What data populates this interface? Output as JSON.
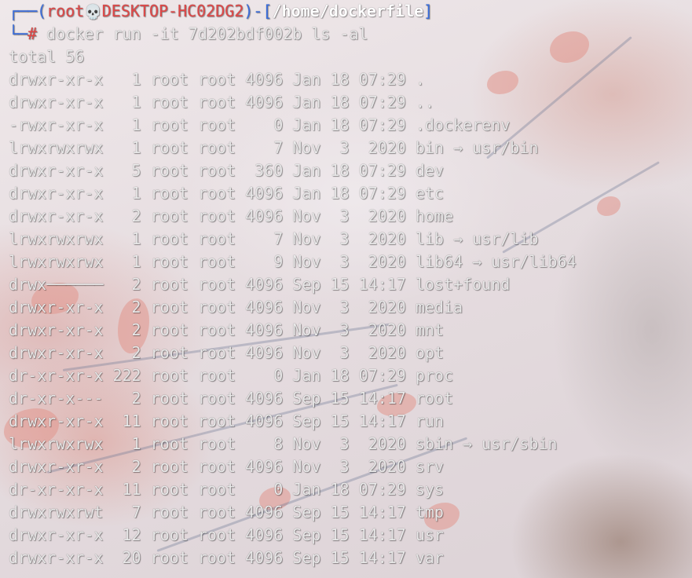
{
  "prompt": {
    "corner_top": "┌──(",
    "user": "root",
    "skull": "💀",
    "host": "DESKTOP-HC02DG2",
    "mid": ")-[",
    "path": "/home/dockerfile",
    "end": "]",
    "corner_bottom": "└─",
    "symbol": "#",
    "command": " docker run -it 7d202bdf002b ls -al"
  },
  "total_line": "total 56",
  "listing": [
    {
      "perms": "drwxr-xr-x",
      "links": "1",
      "owner": "root",
      "group": "root",
      "size": "4096",
      "date": "Jan 18 07:29",
      "name": "."
    },
    {
      "perms": "drwxr-xr-x",
      "links": "1",
      "owner": "root",
      "group": "root",
      "size": "4096",
      "date": "Jan 18 07:29",
      "name": ".."
    },
    {
      "perms": "-rwxr-xr-x",
      "links": "1",
      "owner": "root",
      "group": "root",
      "size": "0",
      "date": "Jan 18 07:29",
      "name": ".dockerenv"
    },
    {
      "perms": "lrwxrwxrwx",
      "links": "1",
      "owner": "root",
      "group": "root",
      "size": "7",
      "date": "Nov  3  2020",
      "name": "bin → usr/bin"
    },
    {
      "perms": "drwxr-xr-x",
      "links": "5",
      "owner": "root",
      "group": "root",
      "size": "360",
      "date": "Jan 18 07:29",
      "name": "dev"
    },
    {
      "perms": "drwxr-xr-x",
      "links": "1",
      "owner": "root",
      "group": "root",
      "size": "4096",
      "date": "Jan 18 07:29",
      "name": "etc"
    },
    {
      "perms": "drwxr-xr-x",
      "links": "2",
      "owner": "root",
      "group": "root",
      "size": "4096",
      "date": "Nov  3  2020",
      "name": "home"
    },
    {
      "perms": "lrwxrwxrwx",
      "links": "1",
      "owner": "root",
      "group": "root",
      "size": "7",
      "date": "Nov  3  2020",
      "name": "lib → usr/lib"
    },
    {
      "perms": "lrwxrwxrwx",
      "links": "1",
      "owner": "root",
      "group": "root",
      "size": "9",
      "date": "Nov  3  2020",
      "name": "lib64 → usr/lib64"
    },
    {
      "perms": "drwx──────",
      "links": "2",
      "owner": "root",
      "group": "root",
      "size": "4096",
      "date": "Sep 15 14:17",
      "name": "lost+found"
    },
    {
      "perms": "drwxr-xr-x",
      "links": "2",
      "owner": "root",
      "group": "root",
      "size": "4096",
      "date": "Nov  3  2020",
      "name": "media"
    },
    {
      "perms": "drwxr-xr-x",
      "links": "2",
      "owner": "root",
      "group": "root",
      "size": "4096",
      "date": "Nov  3  2020",
      "name": "mnt"
    },
    {
      "perms": "drwxr-xr-x",
      "links": "2",
      "owner": "root",
      "group": "root",
      "size": "4096",
      "date": "Nov  3  2020",
      "name": "opt"
    },
    {
      "perms": "dr-xr-xr-x",
      "links": "222",
      "owner": "root",
      "group": "root",
      "size": "0",
      "date": "Jan 18 07:29",
      "name": "proc"
    },
    {
      "perms": "dr-xr-x---",
      "links": "2",
      "owner": "root",
      "group": "root",
      "size": "4096",
      "date": "Sep 15 14:17",
      "name": "root"
    },
    {
      "perms": "drwxr-xr-x",
      "links": "11",
      "owner": "root",
      "group": "root",
      "size": "4096",
      "date": "Sep 15 14:17",
      "name": "run"
    },
    {
      "perms": "lrwxrwxrwx",
      "links": "1",
      "owner": "root",
      "group": "root",
      "size": "8",
      "date": "Nov  3  2020",
      "name": "sbin → usr/sbin"
    },
    {
      "perms": "drwxr-xr-x",
      "links": "2",
      "owner": "root",
      "group": "root",
      "size": "4096",
      "date": "Nov  3  2020",
      "name": "srv"
    },
    {
      "perms": "dr-xr-xr-x",
      "links": "11",
      "owner": "root",
      "group": "root",
      "size": "0",
      "date": "Jan 18 07:29",
      "name": "sys"
    },
    {
      "perms": "drwxrwxrwt",
      "links": "7",
      "owner": "root",
      "group": "root",
      "size": "4096",
      "date": "Sep 15 14:17",
      "name": "tmp"
    },
    {
      "perms": "drwxr-xr-x",
      "links": "12",
      "owner": "root",
      "group": "root",
      "size": "4096",
      "date": "Sep 15 14:17",
      "name": "usr"
    },
    {
      "perms": "drwxr-xr-x",
      "links": "20",
      "owner": "root",
      "group": "root",
      "size": "4096",
      "date": "Sep 15 14:17",
      "name": "var"
    }
  ],
  "colors": {
    "prompt_frame": "#3b6fe0",
    "prompt_user": "#e04848",
    "prompt_path": "#ffffff",
    "text": "#e8e8e8"
  }
}
